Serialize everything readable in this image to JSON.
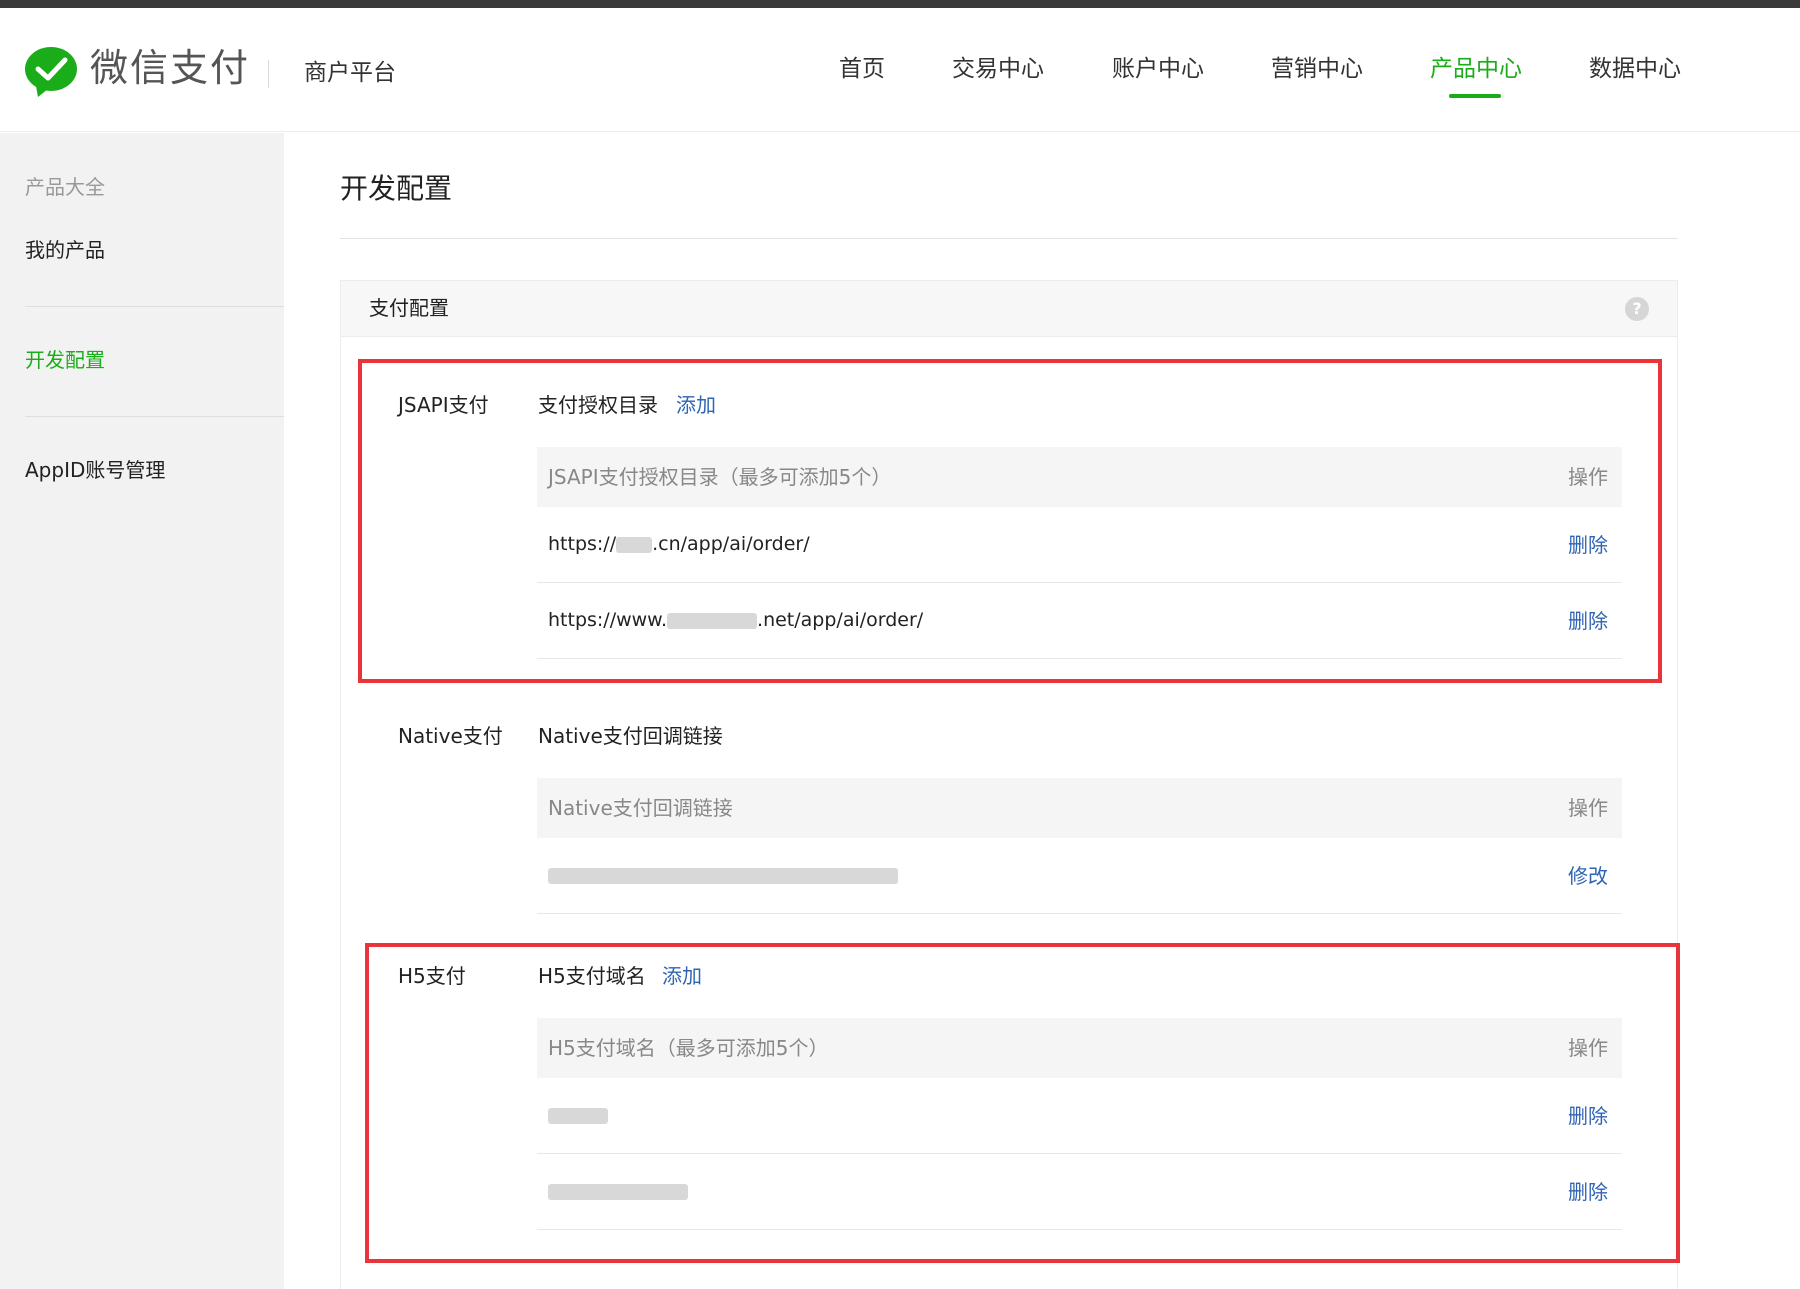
{
  "header": {
    "brand": "微信支付",
    "sub": "商户平台",
    "nav": [
      {
        "label": "首页",
        "active": false
      },
      {
        "label": "交易中心",
        "active": false
      },
      {
        "label": "账户中心",
        "active": false
      },
      {
        "label": "营销中心",
        "active": false
      },
      {
        "label": "产品中心",
        "active": true
      },
      {
        "label": "数据中心",
        "active": false
      }
    ]
  },
  "sidebar": {
    "items": [
      {
        "label": "产品大全",
        "state": "muted"
      },
      {
        "label": "我的产品",
        "state": "normal"
      },
      {
        "label": "开发配置",
        "state": "active"
      },
      {
        "label": "AppID账号管理",
        "state": "normal"
      }
    ]
  },
  "page": {
    "title": "开发配置"
  },
  "panel": {
    "title": "支付配置",
    "help_icon": "?",
    "sections": [
      {
        "label": "JSAPI支付",
        "title": "支付授权目录",
        "add_label": "添加",
        "table_header": "JSAPI支付授权目录（最多可添加5个）",
        "action_header": "操作",
        "rows": [
          {
            "prefix": "https://",
            "suffix": ".cn/app/ai/order/",
            "action": "删除"
          },
          {
            "prefix": "https://www.",
            "suffix": ".net/app/ai/order/",
            "action": "删除"
          }
        ]
      },
      {
        "label": "Native支付",
        "title": "Native支付回调链接",
        "table_header": "Native支付回调链接",
        "action_header": "操作",
        "rows": [
          {
            "action": "修改"
          }
        ]
      },
      {
        "label": "H5支付",
        "title": "H5支付域名",
        "add_label": "添加",
        "table_header": "H5支付域名（最多可添加5个）",
        "action_header": "操作",
        "rows": [
          {
            "action": "删除"
          },
          {
            "action": "删除"
          }
        ]
      }
    ]
  },
  "colors": {
    "accent_green": "#1aad19",
    "link_blue": "#2f64b4",
    "highlight_red": "#e8343a"
  }
}
